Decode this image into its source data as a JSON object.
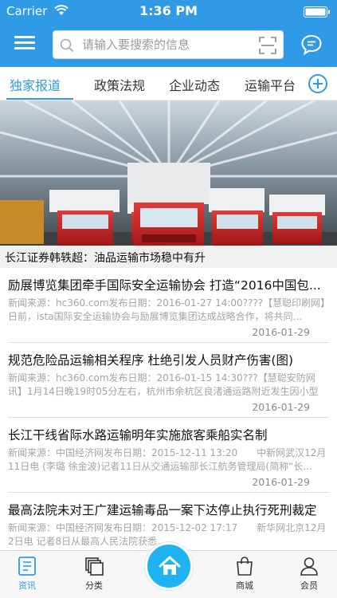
{
  "status_bar": {
    "carrier": "Carrier",
    "time": "1:36 PM",
    "battery_pct": ""
  },
  "header": {
    "search_placeholder": "请输入要搜索的信息"
  },
  "tabs": [
    {
      "label": "独家报道",
      "active": true
    },
    {
      "label": "政策法规",
      "active": false
    },
    {
      "label": "企业动态",
      "active": false
    },
    {
      "label": "运输平台",
      "active": false
    }
  ],
  "banner": {
    "caption": "长江证券韩轶超：油品运输市场稳中有升"
  },
  "news": [
    {
      "title": "励展博览集团牵手国际安全运输协会 打造“2016中国包...",
      "summary": "新闻来源：hc360.com发布日期：2016-01-27 14:00????【慧聪印刷网】日前，ista国际安全运输协会与励展博览集团达成战略合作，将共同...",
      "date": "2016-01-29"
    },
    {
      "title": "规范危险品运输相关程序 杜绝引发人员财产伤害(图)",
      "summary": "新闻来源：hc360.com发布日期：2016-01-15 14:30???【慧聪安防网讯】1月14日晚19时05分左右，杭州市余杭区良渚通运路附近发生因小型煤...",
      "date": "2016-01-29"
    },
    {
      "title": "长江干线省际水路运输明年实施旅客乘船实名制",
      "summary": "新闻来源：中国经济网发布日期：2015-12-11 13:20　　中新网武汉12月11日电 (李璐 徐金波)记者11日从交通运输部长江航务管理局(简称“长...",
      "date": "2016-01-29"
    },
    {
      "title": "最高法院未对王广建运输毒品一案下达停止执行死刑裁定",
      "summary": "新闻来源：中国经济网发布日期：2015-12-02 17:17　　新华网北京12月2日电 记者8日从最高人民法院获悉...",
      "date": "2016-01-29"
    }
  ],
  "tab_bar": {
    "items": [
      {
        "label": "资讯",
        "icon": "news-icon",
        "active": true
      },
      {
        "label": "分类",
        "icon": "category-icon",
        "active": false
      },
      {
        "label": "",
        "icon": "home-icon",
        "active": false
      },
      {
        "label": "商城",
        "icon": "shopping-bag-icon",
        "active": false
      },
      {
        "label": "会员",
        "icon": "person-icon",
        "active": false
      }
    ]
  },
  "colors": {
    "brand_blue": "#2f9be6",
    "home_button": "#1fb2f0"
  }
}
